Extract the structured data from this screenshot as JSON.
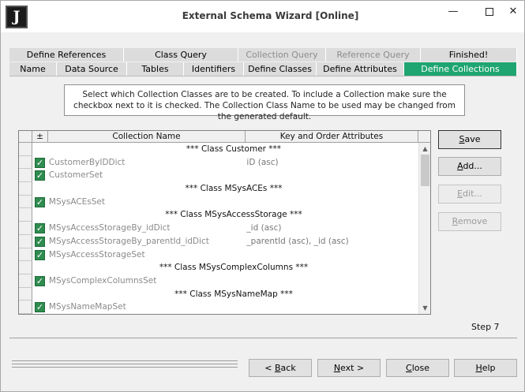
{
  "window": {
    "icon_letter": "J",
    "title": "External Schema Wizard [Online]",
    "minimize_glyph": "—",
    "close_glyph": "✕"
  },
  "tabs_row1": [
    {
      "label": "Define References",
      "enabled": true
    },
    {
      "label": "Class Query",
      "enabled": true
    },
    {
      "label": "Collection Query",
      "enabled": false
    },
    {
      "label": "Reference Query",
      "enabled": false
    },
    {
      "label": "Finished!",
      "enabled": true
    }
  ],
  "tabs_row2": [
    {
      "label": "Name",
      "active": false
    },
    {
      "label": "Data Source",
      "active": false
    },
    {
      "label": "Tables",
      "active": false
    },
    {
      "label": "Identifiers",
      "active": false
    },
    {
      "label": "Define Classes",
      "active": false
    },
    {
      "label": "Define Attributes",
      "active": false
    },
    {
      "label": "Define Collections",
      "active": true
    }
  ],
  "instructions": "Select which Collection Classes are to be created. To include a Collection make sure the checkbox next to it is checked. The Collection Class Name to be used may be changed from the generated default.",
  "grid": {
    "columns": {
      "pm": "±",
      "name": "Collection Name",
      "key": "Key and Order Attributes"
    },
    "rows": [
      {
        "type": "header",
        "name": "*** Class Customer ***"
      },
      {
        "type": "item",
        "checked": true,
        "name": "CustomerByIDDict",
        "key": "iD (asc)"
      },
      {
        "type": "item",
        "checked": true,
        "name": "CustomerSet",
        "key": ""
      },
      {
        "type": "header",
        "name": "*** Class MSysACEs ***"
      },
      {
        "type": "item",
        "checked": true,
        "name": "MSysACEsSet",
        "key": ""
      },
      {
        "type": "header",
        "name": "*** Class MSysAccessStorage ***"
      },
      {
        "type": "item",
        "checked": true,
        "name": "MSysAccessStorageBy_idDict",
        "key": "_id (asc)"
      },
      {
        "type": "item",
        "checked": true,
        "name": "MSysAccessStorageBy_parentId_idDict",
        "key": "_parentId (asc), _id (asc)"
      },
      {
        "type": "item",
        "checked": true,
        "name": "MSysAccessStorageSet",
        "key": ""
      },
      {
        "type": "header",
        "name": "*** Class MSysComplexColumns ***"
      },
      {
        "type": "item",
        "checked": true,
        "name": "MSysComplexColumnsSet",
        "key": ""
      },
      {
        "type": "header",
        "name": "*** Class MSysNameMap ***"
      },
      {
        "type": "item",
        "checked": true,
        "name": "MSysNameMapSet",
        "key": ""
      }
    ]
  },
  "side_buttons": {
    "save": "Save",
    "add": "Add...",
    "edit": "Edit...",
    "remove": "Remove"
  },
  "step": "Step 7",
  "nav": {
    "back": "< Back",
    "next": "Next >",
    "close": "Close",
    "help": "Help"
  },
  "colors": {
    "active_tab": "#1fa572",
    "checkbox": "#2f8b4f"
  }
}
